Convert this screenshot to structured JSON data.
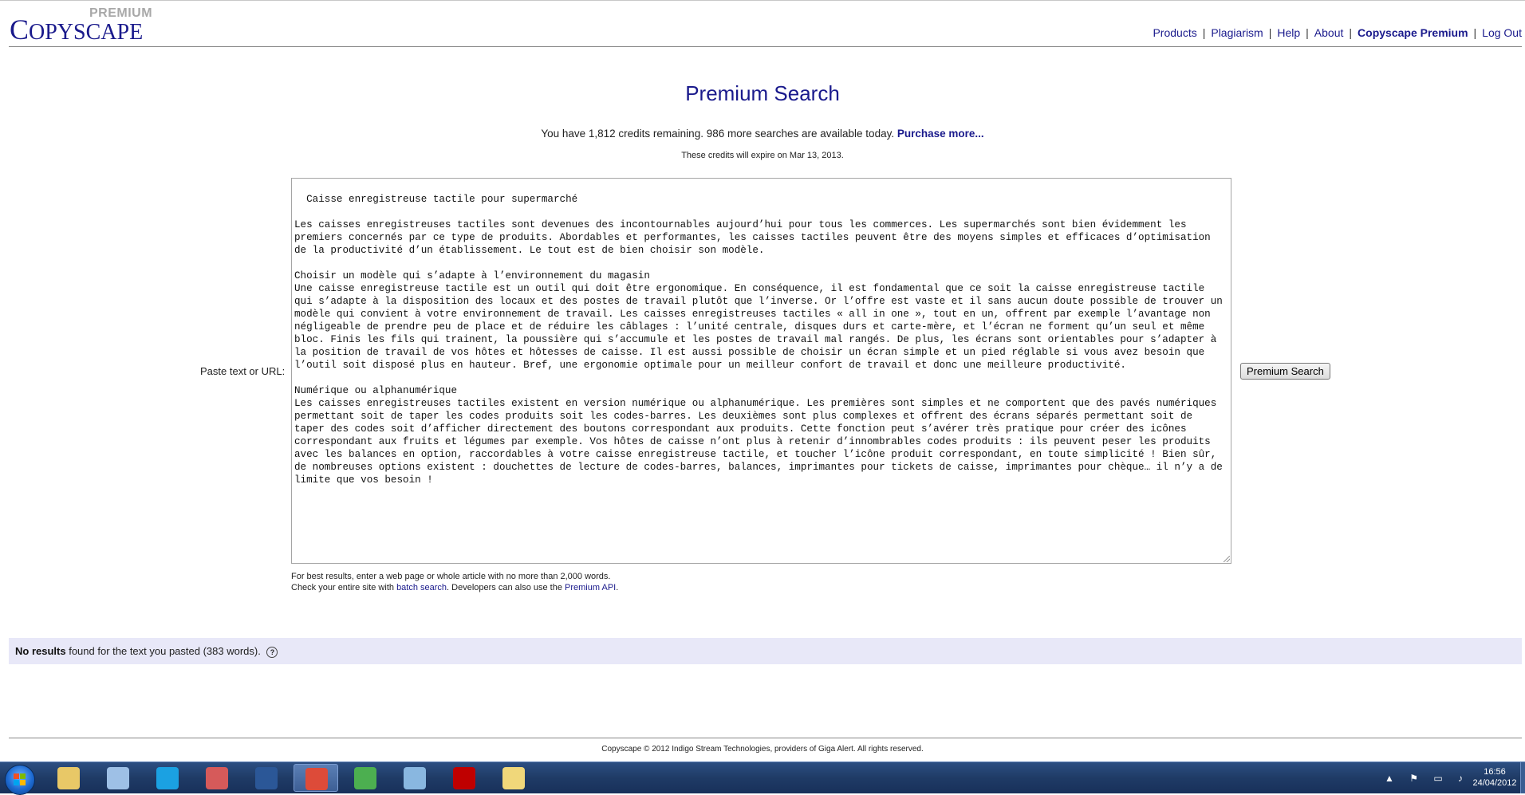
{
  "header": {
    "logo_main_big": "C",
    "logo_main_rest": "OPYSCAPE",
    "logo_premium": "PREMIUM",
    "nav": [
      {
        "label": "Products"
      },
      {
        "label": "Plagiarism"
      },
      {
        "label": "Help"
      },
      {
        "label": "About"
      },
      {
        "label": "Copyscape Premium"
      },
      {
        "label": "Log Out"
      }
    ]
  },
  "main": {
    "title": "Premium Search",
    "credits_text": "You have 1,812 credits remaining. 986 more searches are available today.",
    "purchase_link": "Purchase more...",
    "expire_text": "These credits will expire on Mar 13, 2013.",
    "paste_label": "Paste text or URL:",
    "textarea_value": "Caisse enregistreuse tactile pour supermarché\n\nLes caisses enregistreuses tactiles sont devenues des incontournables aujourd’hui pour tous les commerces. Les supermarchés sont bien évidemment les premiers concernés par ce type de produits. Abordables et performantes, les caisses tactiles peuvent être des moyens simples et efficaces d’optimisation de la productivité d’un établissement. Le tout est de bien choisir son modèle.\n\nChoisir un modèle qui s’adapte à l’environnement du magasin\nUne caisse enregistreuse tactile est un outil qui doit être ergonomique. En conséquence, il est fondamental que ce soit la caisse enregistreuse tactile qui s’adapte à la disposition des locaux et des postes de travail plutôt que l’inverse. Or l’offre est vaste et il sans aucun doute possible de trouver un modèle qui convient à votre environnement de travail. Les caisses enregistreuses tactiles « all in one », tout en un, offrent par exemple l’avantage non négligeable de prendre peu de place et de réduire les câblages : l’unité centrale, disques durs et carte-mère, et l’écran ne forment qu’un seul et même bloc. Finis les fils qui trainent, la poussière qui s’accumule et les postes de travail mal rangés. De plus, les écrans sont orientables pour s’adapter à la position de travail de vos hôtes et hôtesses de caisse. Il est aussi possible de choisir un écran simple et un pied réglable si vous avez besoin que l’outil soit disposé plus en hauteur. Bref, une ergonomie optimale pour un meilleur confort de travail et donc une meilleure productivité.\n\nNumérique ou alphanumérique\nLes caisses enregistreuses tactiles existent en version numérique ou alphanumérique. Les premières sont simples et ne comportent que des pavés numériques permettant soit de taper les codes produits soit les codes-barres. Les deuxièmes sont plus complexes et offrent des écrans séparés permettant soit de taper des codes soit d’afficher directement des boutons correspondant aux produits. Cette fonction peut s’avérer très pratique pour créer des icônes correspondant aux fruits et légumes par exemple. Vos hôtes de caisse n’ont plus à retenir d’innombrables codes produits : ils peuvent peser les produits avec les balances en option, raccordables à votre caisse enregistreuse tactile, et toucher l’icône produit correspondant, en toute simplicité ! Bien sûr, de nombreuses options existent : douchettes de lecture de codes-barres, balances, imprimantes pour tickets de caisse, imprimantes pour chèque… il n’y a de limite que vos besoin !",
    "search_button": "Premium Search",
    "hint_line1": "For best results, enter a web page or whole article with no more than 2,000 words.",
    "hint_line2_a": "Check your entire site with",
    "hint_batch_link": "batch search",
    "hint_line2_b": ". Developers can also use the",
    "hint_api_link": "Premium API",
    "hint_line2_c": "."
  },
  "results": {
    "bold": "No results",
    "text": "found for the text you pasted (383 words).",
    "help_icon": "?"
  },
  "footer": {
    "text": "Copyscape © 2012 Indigo Stream Technologies, providers of Giga Alert. All rights reserved."
  },
  "taskbar": {
    "apps": [
      {
        "name": "explorer-icon",
        "color": "#e8c867"
      },
      {
        "name": "mail-icon",
        "color": "#9ec0e6"
      },
      {
        "name": "skype-icon",
        "color": "#1ba1e2"
      },
      {
        "name": "snipping-tool-icon",
        "color": "#d65a5a"
      },
      {
        "name": "word-icon",
        "color": "#2b5797"
      },
      {
        "name": "chrome-icon",
        "color": "#dd4b39"
      },
      {
        "name": "spreadsheet-icon",
        "color": "#4caf50"
      },
      {
        "name": "notepad-icon",
        "color": "#89b7e0"
      },
      {
        "name": "filezilla-icon",
        "color": "#bf0000"
      },
      {
        "name": "folder-icon",
        "color": "#f0d77a"
      }
    ],
    "clock_time": "16:56",
    "clock_date": "24/04/2012"
  },
  "colors": {
    "brand": "#1a1a8c",
    "results_bg": "#e8e8f8"
  }
}
